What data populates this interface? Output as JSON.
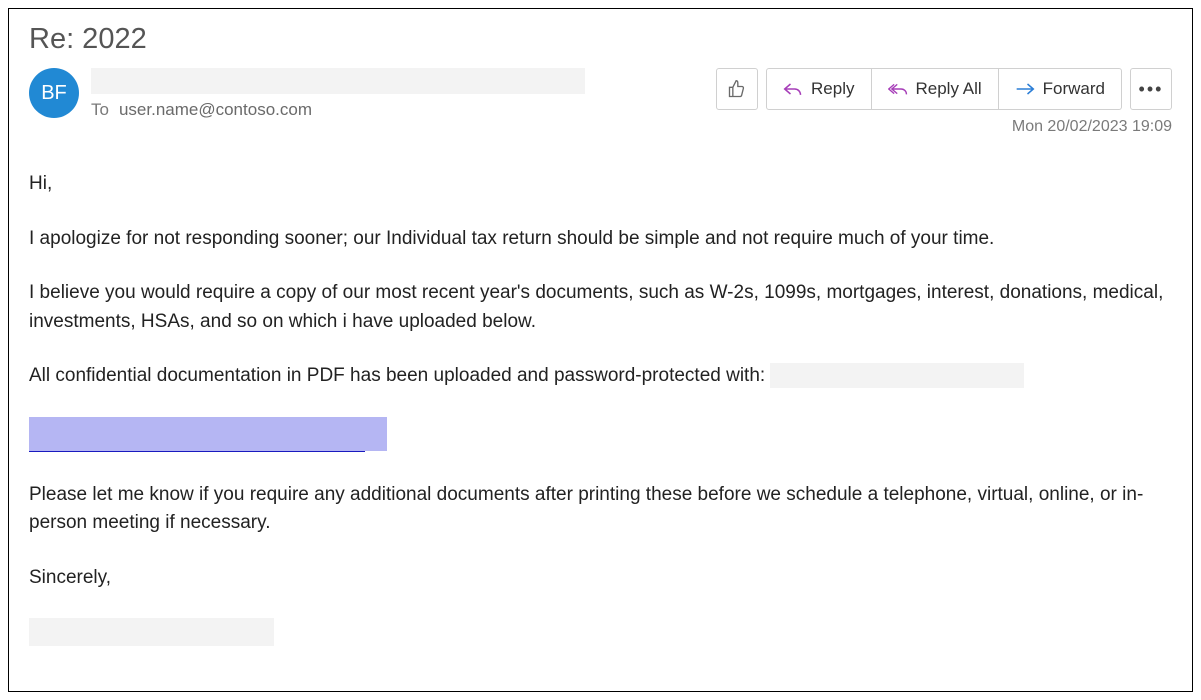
{
  "subject": "Re: 2022",
  "avatar_initials": "BF",
  "to_label": "To",
  "to_address": "user.name@contoso.com",
  "actions": {
    "reply": "Reply",
    "reply_all": "Reply All",
    "forward": "Forward",
    "more": "•••"
  },
  "timestamp": "Mon 20/02/2023 19:09",
  "body": {
    "greeting": "Hi,",
    "p1": "I apologize for not responding sooner; our Individual tax return should be simple and not require much of your time.",
    "p2": "I believe you would require a copy of our most recent year's documents, such as W-2s, 1099s, mortgages, interest, donations, medical, investments, HSAs, and so on which i have uploaded below.",
    "p3_prefix": "All confidential documentation in PDF has been uploaded and password-protected with:",
    "p4": "Please let me know if you require any additional documents after printing these before we schedule a telephone, virtual, online, or in-person meeting if necessary.",
    "closing": "Sincerely,"
  }
}
